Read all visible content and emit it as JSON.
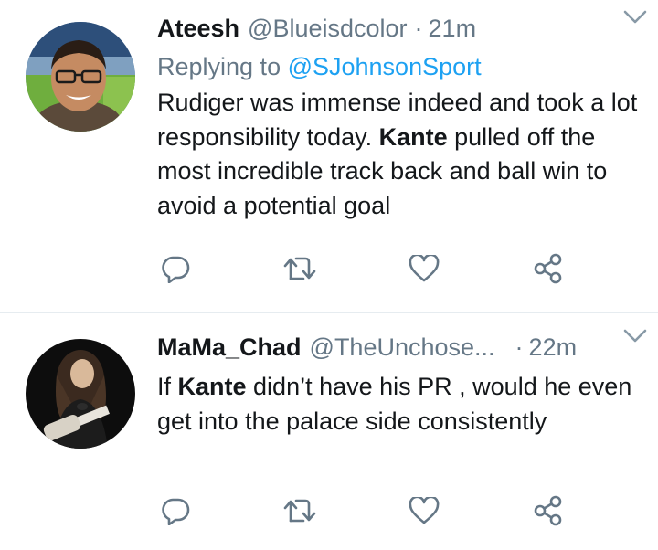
{
  "colors": {
    "text": "#14171a",
    "secondary": "#657786",
    "link": "#1da1f2",
    "divider": "#e6ecf0",
    "icon": "#657786"
  },
  "tweets": [
    {
      "name": "Ateesh",
      "handle": "@Blueisdcolor",
      "dot": "·",
      "time": "21m",
      "replying_prefix": "Replying to ",
      "replying_to": "@SJohnsonSport",
      "text_parts": [
        "Rudiger was immense indeed and took a lot responsibility today. ",
        "Kante",
        " pulled off the most incredible track back and ball win to avoid a potential goal"
      ],
      "avatar_icon": "profile-photo"
    },
    {
      "name": "MaMa_Chad",
      "handle": "@TheUnchose...",
      "dot": "·",
      "time": "22m",
      "text_parts": [
        "If ",
        "Kante",
        " didn’t have his PR , would he even get into the palace side consistently"
      ],
      "avatar_icon": "profile-photo"
    }
  ],
  "icons": {
    "reply": "reply-icon",
    "retweet": "retweet-icon",
    "like": "heart-icon",
    "share": "share-icon",
    "menu": "chevron-down-icon"
  }
}
